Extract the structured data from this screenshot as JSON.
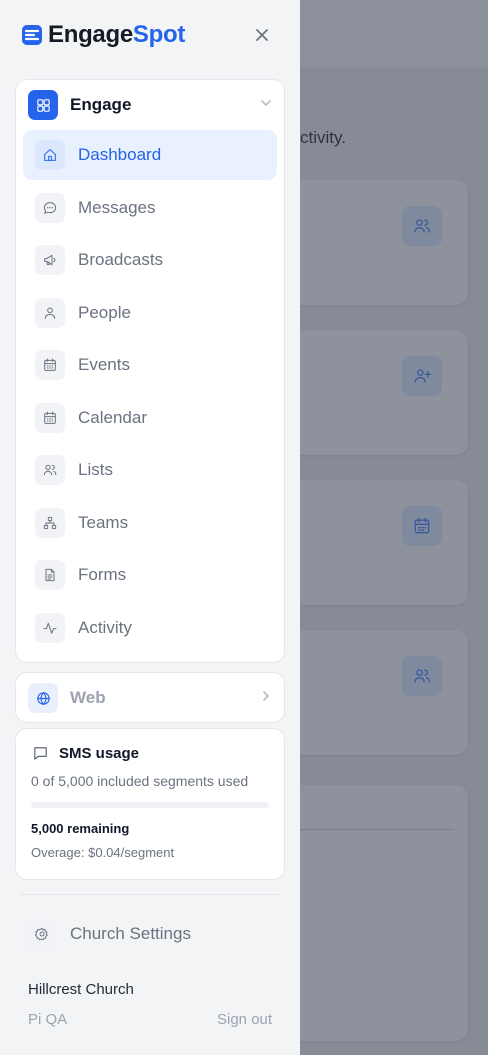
{
  "brand": {
    "word1": "Engage",
    "word2": "Spot"
  },
  "background": {
    "text": "ctivity."
  },
  "engage_group": {
    "title": "Engage"
  },
  "nav_items": [
    {
      "label": "Dashboard",
      "icon": "home-icon",
      "active": true
    },
    {
      "label": "Messages",
      "icon": "chat-bubble-icon",
      "active": false
    },
    {
      "label": "Broadcasts",
      "icon": "megaphone-icon",
      "active": false
    },
    {
      "label": "People",
      "icon": "person-icon",
      "active": false
    },
    {
      "label": "Events",
      "icon": "calendar-grid-icon",
      "active": false
    },
    {
      "label": "Calendar",
      "icon": "calendar-icon",
      "active": false
    },
    {
      "label": "Lists",
      "icon": "users-icon",
      "active": false
    },
    {
      "label": "Teams",
      "icon": "org-chart-icon",
      "active": false
    },
    {
      "label": "Forms",
      "icon": "document-icon",
      "active": false
    },
    {
      "label": "Activity",
      "icon": "activity-pulse-icon",
      "active": false
    }
  ],
  "web_group": {
    "title": "Web"
  },
  "sms_usage": {
    "title": "SMS usage",
    "used_text": "0 of 5,000 included segments used",
    "used_fraction": 0,
    "remaining": "5,000 remaining",
    "overage": "Overage: $0.04/segment"
  },
  "footer": {
    "settings_label": "Church Settings",
    "church_name": "Hillcrest Church",
    "user_name": "Pi QA",
    "sign_out": "Sign out"
  },
  "colors": {
    "accent": "#2563eb",
    "overlay": "#868b95",
    "drawer": "#f3f4f6"
  }
}
